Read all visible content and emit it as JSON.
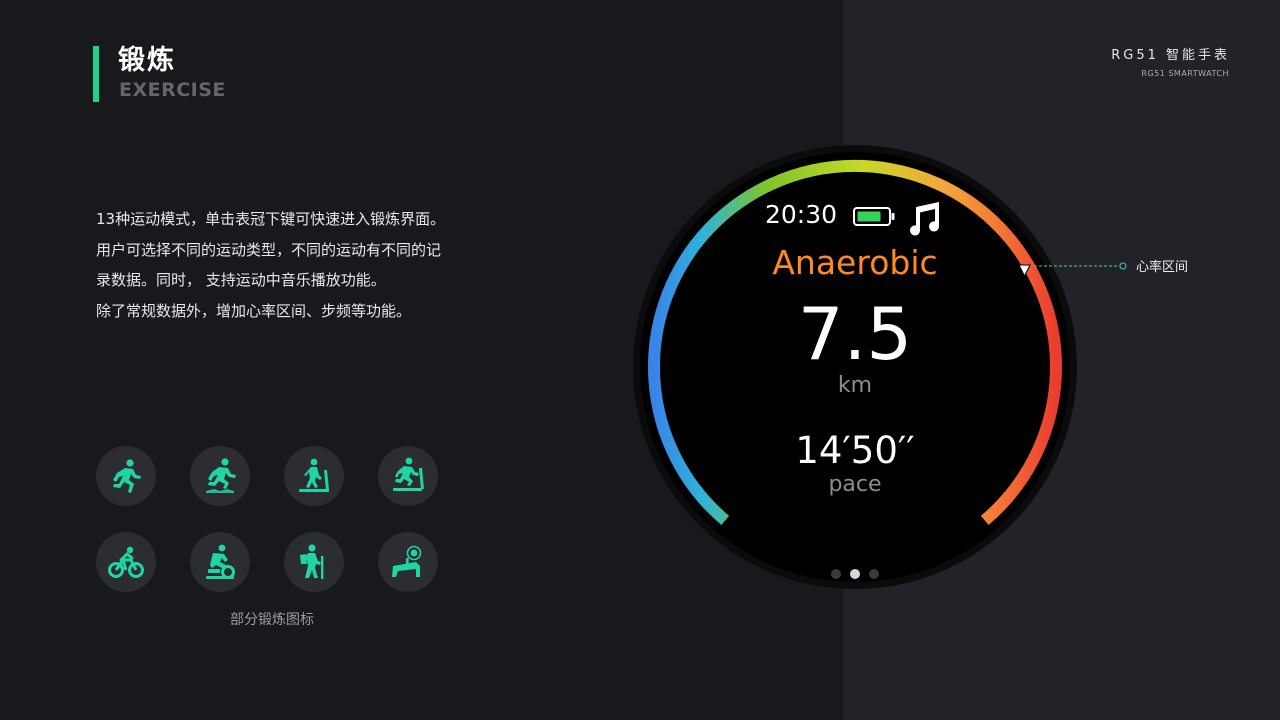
{
  "header": {
    "title_cn": "锻炼",
    "title_en": "EXERCISE",
    "brand_cn": "RG51 智能手表",
    "brand_en": "RG51 SMARTWATCH"
  },
  "description": {
    "line1": "13种运动模式，单击表冠下键可快速进入锻炼界面。用户可选择不同的运动类型，不同的运动有不同的记录数据。同时， 支持运动中音乐播放功能。",
    "line2": "除了常规数据外，增加心率区间、步频等功能。"
  },
  "icons": {
    "caption": "部分锻炼图标",
    "items": [
      "outdoor-run-icon",
      "trail-run-icon",
      "treadmill-walk-icon",
      "treadmill-run-icon",
      "outdoor-cycle-icon",
      "indoor-cycle-icon",
      "hiking-icon",
      "strength-training-icon"
    ],
    "accent_color": "#1fd5a0"
  },
  "watch": {
    "time": "20:30",
    "mode": "Anaerobic",
    "distance_value": "7.5",
    "distance_unit": "km",
    "pace_value": "14′50′′",
    "pace_unit": "pace",
    "battery_icon": "battery-icon",
    "music_icon": "music-note-icon",
    "page_indicator_count": 3,
    "page_indicator_active": 2,
    "mode_color": "#ff8a1e",
    "battery_color": "#34d35a"
  },
  "callout": {
    "label": "心率区间"
  }
}
